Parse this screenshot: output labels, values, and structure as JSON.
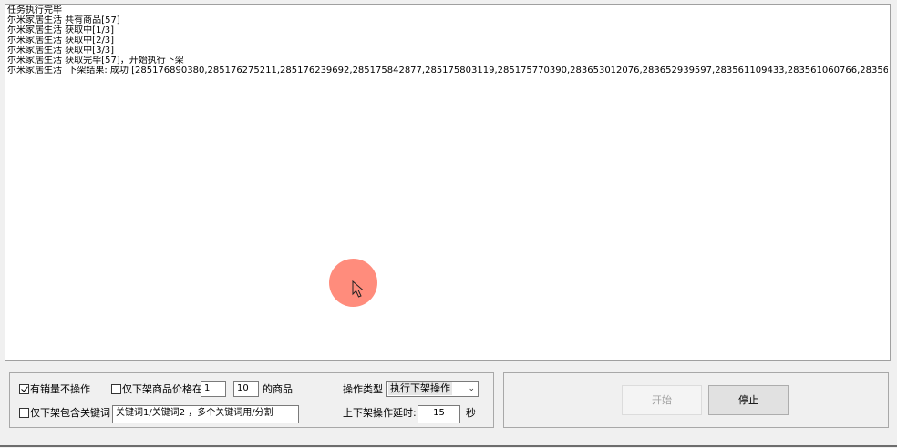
{
  "log": {
    "lines": [
      "任务执行完毕",
      "尔米家居生活 共有商品[57]",
      "尔米家居生活 获取中[1/3]",
      "尔米家居生活 获取中[2/3]",
      "尔米家居生活 获取中[3/3]",
      "尔米家居生活 获取完毕[57]，开始执行下架",
      "尔米家居生活  下架结果: 成功 [285176890380,285176275211,285176239692,285175842877,285175803119,285175770390,283653012076,283652939597,283561109433,283561060766,283561059794,283561011085,28356"
    ]
  },
  "options": {
    "no_sales_label": "有销量不操作",
    "no_sales_checked": true,
    "price_range_label": "仅下架商品价格在",
    "price_range_checked": false,
    "price_min": "1",
    "price_max": "10",
    "price_suffix": "的商品",
    "keyword_label": "仅下架包含关键词",
    "keyword_checked": false,
    "keyword_value": "关键词1/关键词2 ，多个关键词用/分割",
    "op_type_label": "操作类型",
    "op_type_value": "执行下架操作",
    "delay_label": "上下架操作延时:",
    "delay_value": "15",
    "delay_unit": "秒"
  },
  "actions": {
    "start_label": "开始",
    "stop_label": "停止"
  },
  "icons": {
    "cursor": "cursor-arrow-icon",
    "dropdown": "chevron-down-icon",
    "highlight_color": "#ff7f6e"
  }
}
